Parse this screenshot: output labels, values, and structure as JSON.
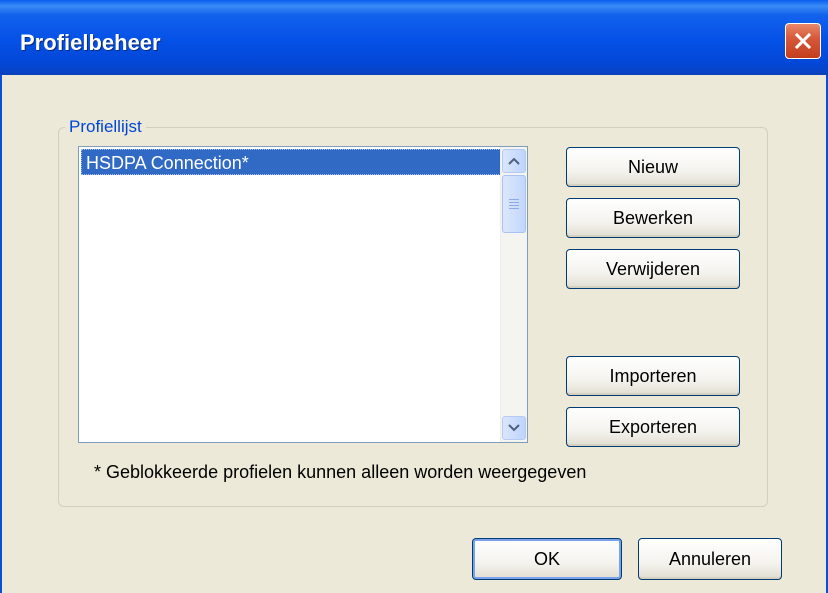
{
  "window": {
    "title": "Profielbeheer"
  },
  "group": {
    "label": "Profiellijst"
  },
  "profiles": [
    "HSDPA Connection*"
  ],
  "buttons": {
    "new": "Nieuw",
    "edit": "Bewerken",
    "delete": "Verwijderen",
    "import": "Importeren",
    "export": "Exporteren",
    "ok": "OK",
    "cancel": "Annuleren"
  },
  "note": "* Geblokkeerde profielen kunnen alleen worden weergegeven",
  "colors": {
    "titlebar": "#0550e6",
    "selection": "#316ac5",
    "close": "#d75a3a",
    "dialog_bg": "#ece9d8"
  },
  "icons": {
    "close": "close-icon",
    "scroll_up": "chevron-up-icon",
    "scroll_down": "chevron-down-icon"
  }
}
